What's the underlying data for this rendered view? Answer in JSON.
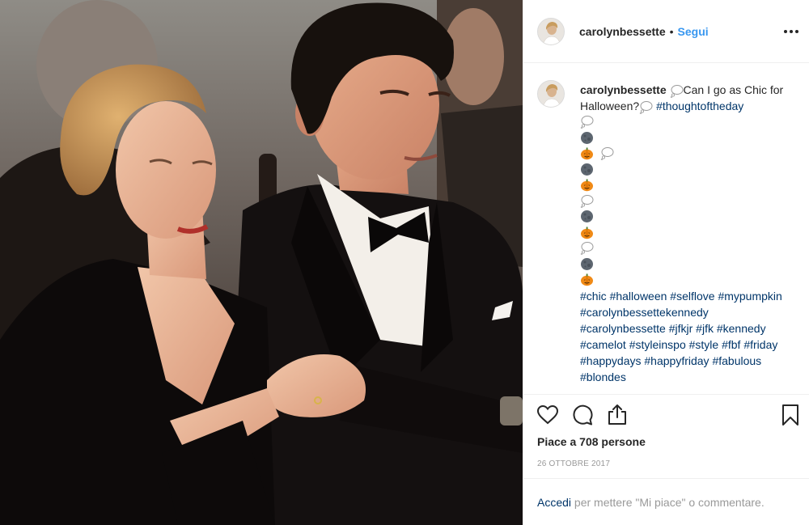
{
  "post": {
    "username": "carolynbessette",
    "dot": "•",
    "follow_label": "Segui",
    "caption_intro": "Can I go as Chic for Halloween?",
    "hashtags_first": "#thoughtoftheday",
    "hashtags_rest": "#chic #halloween #selflove #mypumpkin #carolynbessettekennedy #carolynbessette #jfkjr #jfk #kennedy #camelot #styleinspo #style #fbf #friday #happydays #happyfriday #fabulous #blondes",
    "emoji_lines": [
      [
        "thought-balloon"
      ],
      [
        "new-moon"
      ],
      [
        "pumpkin",
        "thought-balloon"
      ],
      [
        "new-moon"
      ],
      [
        "pumpkin"
      ],
      [
        "thought-balloon"
      ],
      [
        "new-moon"
      ],
      [
        "pumpkin"
      ],
      [
        "thought-balloon"
      ],
      [
        "new-moon"
      ],
      [
        "pumpkin"
      ]
    ],
    "likes_text": "Piace a 708 persone",
    "date": "26 OTTOBRE 2017",
    "login_link": "Accedi",
    "login_text": " per mettere \"Mi piace\" o commentare."
  },
  "icons": {
    "like": "heart-icon",
    "comment": "comment-icon",
    "share": "share-icon",
    "save": "bookmark-icon",
    "more": "more-options-icon"
  },
  "colors": {
    "link": "#3897f0",
    "hashtag": "#003569",
    "muted": "#999999",
    "text": "#262626",
    "border": "#efefef"
  }
}
